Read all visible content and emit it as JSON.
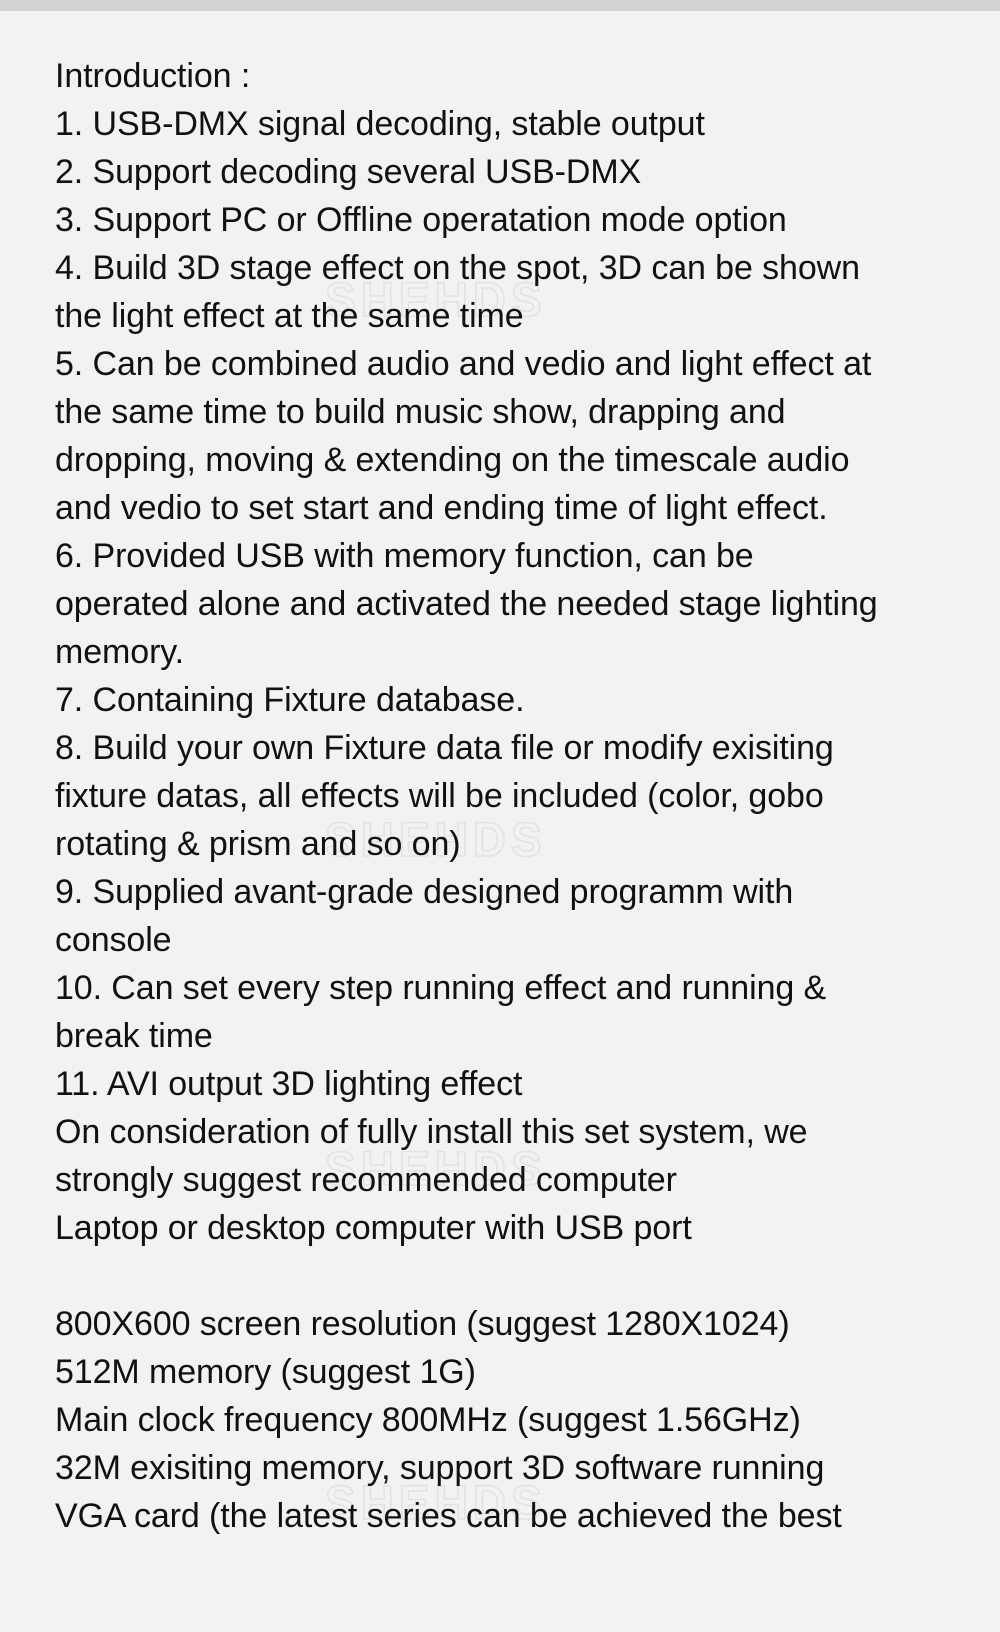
{
  "page": {
    "background_color": "#f2f2f2",
    "top_strip_color": "#d2d2d2",
    "text_color": "#111111"
  },
  "watermark": {
    "text": "SHEHDS",
    "color": "#e2e2e2",
    "occurrences": 4
  },
  "document": {
    "heading": "Introduction :",
    "lines": [
      "Introduction :",
      "1. USB-DMX signal decoding, stable output",
      "2. Support decoding several USB-DMX",
      "3. Support PC or Offline operatation mode option",
      "4. Build 3D stage effect on the spot, 3D can be shown",
      "the light effect at the same time",
      "5. Can be combined audio and vedio and light effect at",
      "the same time to build music show, drapping and",
      "dropping, moving & extending on the timescale audio",
      "and vedio to set start and ending time of light effect.",
      "6. Provided USB with memory function, can be",
      "operated alone and activated the needed stage lighting",
      "memory.",
      "7. Containing Fixture database.",
      "8. Build your own Fixture data file or modify exisiting",
      "fixture datas, all effects will be included (color, gobo",
      "rotating & prism and so on)",
      "9. Supplied avant-grade designed programm with",
      "console",
      "10. Can set every step running effect and running &",
      "break time",
      "11. AVI output 3D lighting effect",
      "On consideration of fully install this set system, we",
      "strongly suggest recommended computer",
      "Laptop or desktop computer with USB port",
      "",
      "800X600 screen resolution (suggest 1280X1024)",
      "512M memory (suggest 1G)",
      "Main clock frequency 800MHz (suggest 1.56GHz)",
      "32M exisiting memory, support 3D software running",
      "VGA card (the latest series can be achieved the best"
    ],
    "numbered_items": [
      "1. USB-DMX signal decoding, stable output",
      "2. Support decoding several USB-DMX",
      "3. Support PC or Offline operatation mode option",
      "4. Build 3D stage effect on the spot, 3D can be shown the light effect at the same time",
      "5. Can be combined audio and vedio and light effect at the same time to build music show, drapping and dropping, moving & extending on the timescale audio and vedio to set start and ending time of light effect.",
      "6. Provided USB with memory function, can be operated alone and activated the needed stage lighting memory.",
      "7. Containing Fixture database.",
      "8. Build your own Fixture data file or modify exisiting fixture datas, all effects will be included (color, gobo rotating & prism and so on)",
      "9. Supplied avant-grade designed programm with console",
      "10. Can set every step running effect and running & break time",
      "11. AVI output 3D lighting effect"
    ],
    "requirements": [
      "800X600 screen resolution (suggest 1280X1024)",
      "512M memory (suggest 1G)",
      "Main clock frequency 800MHz (suggest 1.56GHz)",
      "32M exisiting memory, support 3D software running",
      "VGA card (the latest series can be achieved the best"
    ]
  }
}
